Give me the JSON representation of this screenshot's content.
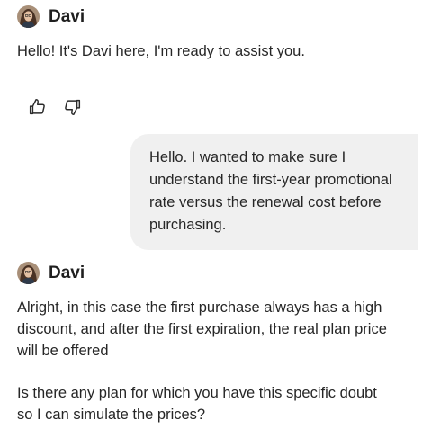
{
  "agent": {
    "name": "Davi",
    "avatar_icon": "person-avatar-icon"
  },
  "messages": [
    {
      "role": "agent",
      "text": "Hello! It's Davi here, I'm ready to assist you."
    },
    {
      "role": "user",
      "text": "Hello. I wanted to make sure I understand the first-year promotional rate versus the renewal cost before purchasing."
    },
    {
      "role": "agent",
      "text": "Alright, in this case the first purchase always has a high discount, and after the first expiration, the real plan price will be offered"
    },
    {
      "role": "agent",
      "text": "Is there any plan for which you have this specific doubt so I can simulate the prices?"
    }
  ],
  "feedback": {
    "like_icon": "thumbs-up-icon",
    "dislike_icon": "thumbs-down-icon"
  },
  "colors": {
    "user_bubble": "#f0f0f0",
    "text": "#262626"
  }
}
